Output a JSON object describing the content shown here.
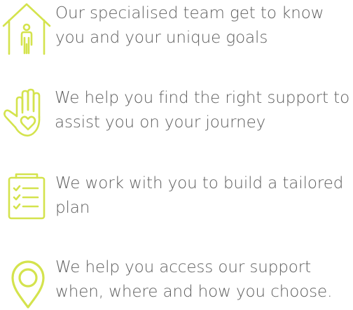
{
  "colors": {
    "icon": "#d4e34d",
    "text": "#5f5f5f",
    "background": "#ffffff"
  },
  "steps": [
    {
      "icon": "home-person-icon",
      "text": "Our specialised team get to know you and your unique goals"
    },
    {
      "icon": "hand-heart-icon",
      "text": "We help you find the right support to assist you on your journey"
    },
    {
      "icon": "checklist-icon",
      "text": "We work with you to build a tailored plan"
    },
    {
      "icon": "location-pin-icon",
      "text": "We help you access our support when, where and how you choose."
    }
  ]
}
